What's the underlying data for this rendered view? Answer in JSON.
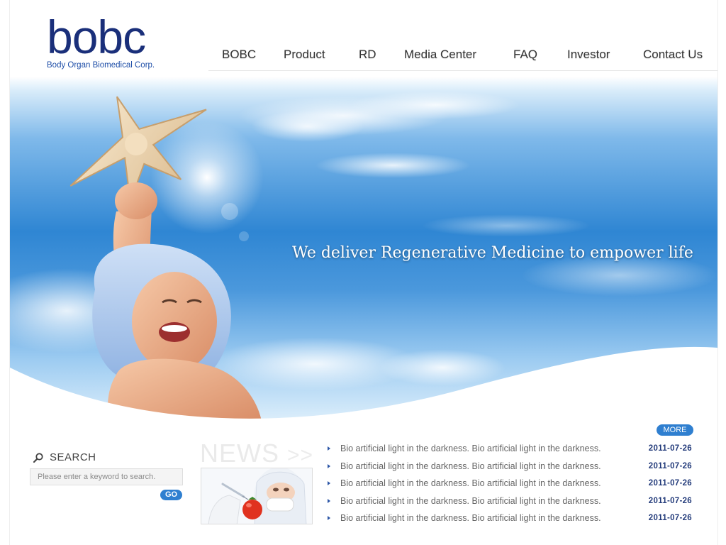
{
  "brand": {
    "logo_text": "bobc",
    "logo_subtitle": "Body Organ Biomedical Corp."
  },
  "nav": {
    "items": [
      {
        "label": "BOBC"
      },
      {
        "label": "Product"
      },
      {
        "label": "RD"
      },
      {
        "label": "Media  Center"
      },
      {
        "label": "FAQ"
      },
      {
        "label": "Investor"
      },
      {
        "label": "Contact Us"
      }
    ]
  },
  "hero": {
    "tagline": "We deliver Regenerative Medicine to empower life"
  },
  "search": {
    "title": "SEARCH",
    "placeholder": "Please enter a keyword to search.",
    "button_label": "GO"
  },
  "news": {
    "heading": "NEWS",
    "heading_arrows": ">>",
    "more_label": "MORE",
    "items": [
      {
        "title": "Bio artificial light in the darkness. Bio artificial light in the darkness.",
        "date": "2011-07-26"
      },
      {
        "title": "Bio artificial light in the darkness. Bio artificial light in the darkness.",
        "date": "2011-07-26"
      },
      {
        "title": "Bio artificial light in the darkness. Bio artificial light in the darkness.",
        "date": "2011-07-26"
      },
      {
        "title": "Bio artificial light in the darkness. Bio artificial light in the darkness.",
        "date": "2011-07-26"
      },
      {
        "title": "Bio artificial light in the darkness. Bio artificial light in the darkness.",
        "date": "2011-07-26"
      }
    ]
  },
  "colors": {
    "brand_navy": "#1a2f7a",
    "accent_blue": "#2f7fd0",
    "date_color": "#223a7a"
  }
}
